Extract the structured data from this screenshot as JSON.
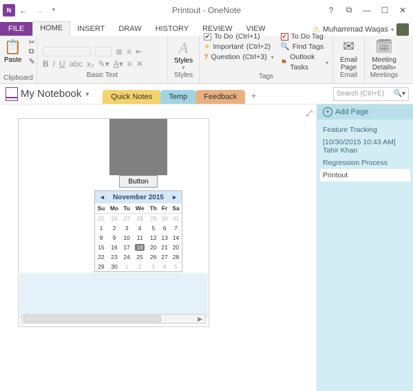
{
  "titlebar": {
    "title": "Printout - OneNote",
    "app_abbrev": "N"
  },
  "ribbon": {
    "file": "FILE",
    "tabs": [
      "HOME",
      "INSERT",
      "DRAW",
      "HISTORY",
      "REVIEW",
      "VIEW"
    ],
    "active_tab": "HOME",
    "user": "Muhammad Waqas",
    "groups": {
      "clipboard": {
        "paste": "Paste",
        "label": "Clipboard"
      },
      "basic_text": {
        "label": "Basic Text"
      },
      "styles": {
        "label": "Styles",
        "btn": "Styles"
      },
      "tags": {
        "label": "Tags",
        "items": [
          {
            "name": "To Do",
            "shortcut": "(Ctrl+1)"
          },
          {
            "name": "Important",
            "shortcut": "(Ctrl+2)"
          },
          {
            "name": "Question",
            "shortcut": "(Ctrl+3)"
          }
        ],
        "actions": [
          "To Do Tag",
          "Find Tags",
          "Outlook Tasks"
        ]
      },
      "email": {
        "line1": "Email",
        "line2": "Page",
        "label": "Email"
      },
      "meetings": {
        "line1": "Meeting",
        "line2": "Details",
        "label": "Meetings"
      }
    }
  },
  "notebook": {
    "name": "My Notebook",
    "tabs": [
      "Quick Notes",
      "Temp",
      "Feedback"
    ],
    "active": "Temp",
    "search_placeholder": "Search (Ctrl+E)"
  },
  "page_pane": {
    "add": "Add Page",
    "pages": [
      "Feature Tracking",
      "[10/30/2015 10:43 AM] Tahir Khan",
      "Regression Process",
      "Printout"
    ],
    "selected": "Printout"
  },
  "printout": {
    "button_label": "Button",
    "calendar": {
      "title": "November 2015",
      "dow": [
        "Su",
        "Mo",
        "Tu",
        "We",
        "Th",
        "Fr",
        "Sa"
      ],
      "weeks": [
        [
          {
            "d": 25,
            "m": true
          },
          {
            "d": 26,
            "m": true
          },
          {
            "d": 27,
            "m": true
          },
          {
            "d": 28,
            "m": true
          },
          {
            "d": 29,
            "m": true
          },
          {
            "d": 30,
            "m": true
          },
          {
            "d": 31,
            "m": true
          }
        ],
        [
          {
            "d": 1
          },
          {
            "d": 2
          },
          {
            "d": 3
          },
          {
            "d": 4
          },
          {
            "d": 5
          },
          {
            "d": 6
          },
          {
            "d": 7
          }
        ],
        [
          {
            "d": 8
          },
          {
            "d": 9
          },
          {
            "d": 10
          },
          {
            "d": 11
          },
          {
            "d": 12
          },
          {
            "d": 13
          },
          {
            "d": 14
          }
        ],
        [
          {
            "d": 15
          },
          {
            "d": 16
          },
          {
            "d": 17
          },
          {
            "d": 18,
            "sel": true
          },
          {
            "d": 20
          },
          {
            "d": 21
          },
          {
            "d": 20
          }
        ],
        [
          {
            "d": 22
          },
          {
            "d": 23
          },
          {
            "d": 24
          },
          {
            "d": 25
          },
          {
            "d": 26
          },
          {
            "d": 27
          },
          {
            "d": 28
          }
        ],
        [
          {
            "d": 29
          },
          {
            "d": 30
          },
          {
            "d": 1,
            "m": true
          },
          {
            "d": 2,
            "m": true
          },
          {
            "d": 3,
            "m": true
          },
          {
            "d": 4,
            "m": true
          },
          {
            "d": 5,
            "m": true
          }
        ]
      ]
    }
  }
}
